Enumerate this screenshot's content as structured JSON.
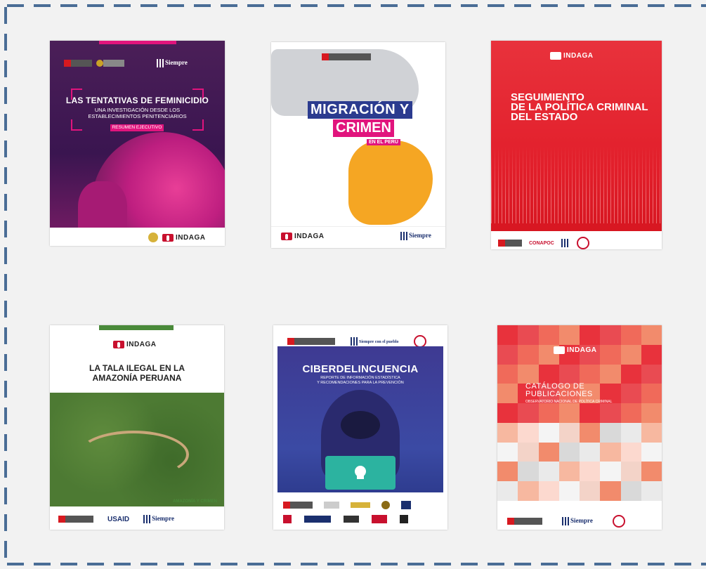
{
  "covers": [
    {
      "id": "c1",
      "title": "LAS TENTATIVAS DE FEMINICIDIO",
      "subtitle": "UNA INVESTIGACIÓN DESDE LOS\nESTABLECIMIENTOS PENITENCIARIOS",
      "badge": "RESUMEN EJECUTIVO",
      "footer_brand": "INDAGA"
    },
    {
      "id": "c2",
      "title_line1": "MIGRACIÓN Y",
      "title_line2": "CRIMEN",
      "tag": "EN EL PERÚ",
      "footer_brand": "INDAGA",
      "footer_slogan": "Siempre con el pueblo"
    },
    {
      "id": "c3",
      "brand": "INDAGA",
      "title": "SEGUIMIENTO\nDE LA POLÍTICA CRIMINAL\nDEL ESTADO",
      "footer_org": "CONAPOC"
    },
    {
      "id": "c4",
      "brand": "INDAGA",
      "title": "LA TALA ILEGAL EN LA\nAMAZONÍA PERUANA",
      "label": "AMAZONÍA Y CRIMEN",
      "footer_usaid": "USAID",
      "footer_slogan": "Siempre con el pueblo"
    },
    {
      "id": "c5",
      "title": "CIBERDELINCUENCIA",
      "subtitle": "REPORTE DE INFORMACIÓN ESTADÍSTICA\nY RECOMENDACIONES PARA LA PREVENCIÓN",
      "header_slogan": "Siempre con el pueblo"
    },
    {
      "id": "c6",
      "brand": "INDAGA",
      "title": "CATÁLOGO DE\nPUBLICACIONES",
      "subtitle": "OBSERVATORIO NACIONAL DE POLÍTICA CRIMINAL",
      "footer_slogan": "Siempre con el pueblo"
    }
  ],
  "colors": {
    "frame_dash": "#4a6d96",
    "background": "#f2f2f2",
    "magenta": "#e1147d",
    "red": "#e21f2b",
    "navy": "#2b3b8f",
    "green": "#4a8a3a",
    "teal": "#2cb3a0"
  }
}
